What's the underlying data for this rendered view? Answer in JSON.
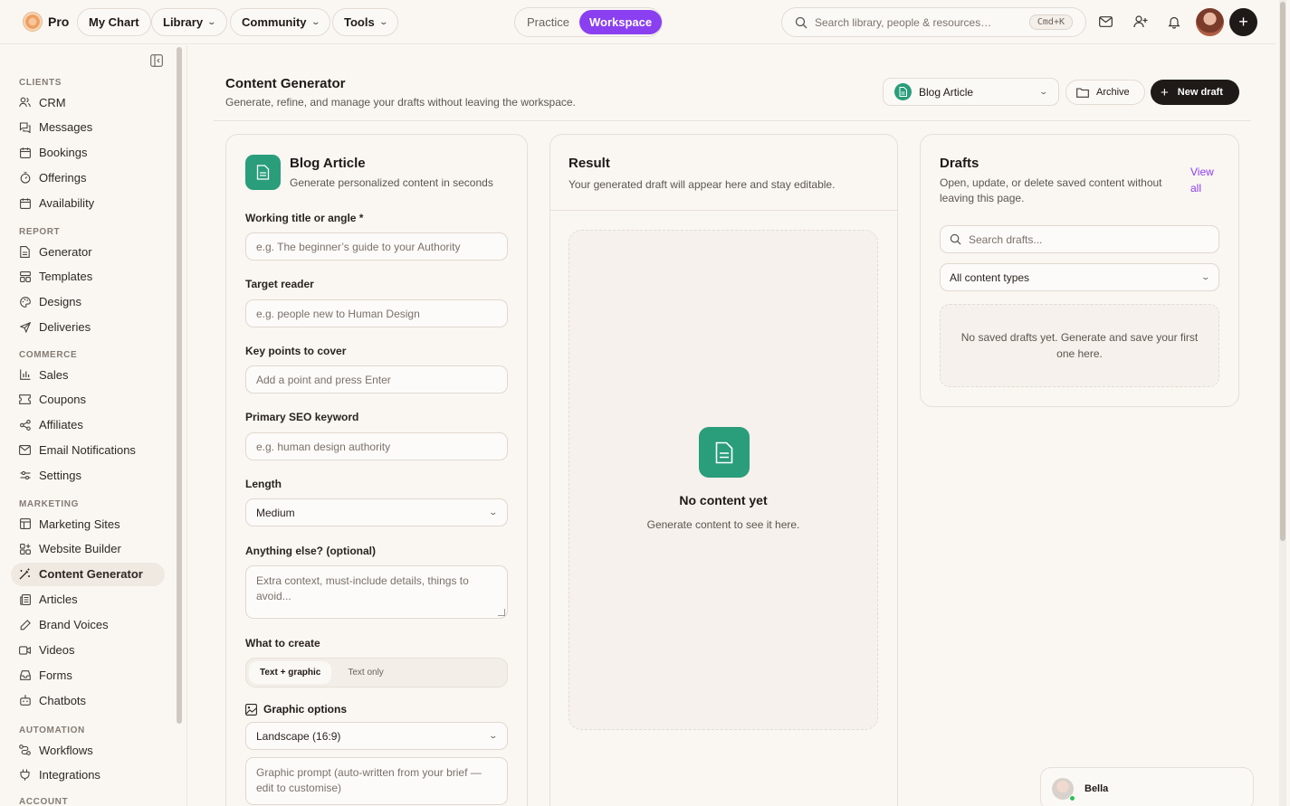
{
  "app": {
    "brand": "Pro"
  },
  "topnav": {
    "items": [
      {
        "label": "My Chart",
        "has_menu": false
      },
      {
        "label": "Library",
        "has_menu": true
      },
      {
        "label": "Community",
        "has_menu": true
      },
      {
        "label": "Tools",
        "has_menu": true
      }
    ],
    "mode_toggle": {
      "options": [
        "Practice",
        "Workspace"
      ],
      "selected": "Workspace"
    },
    "search": {
      "placeholder": "Search library, people & resources…",
      "shortcut": "Cmd+K"
    }
  },
  "sidebar": {
    "sections": [
      {
        "title": "CLIENTS",
        "items": [
          {
            "label": "CRM",
            "icon": "users-icon"
          },
          {
            "label": "Messages",
            "icon": "messages-icon"
          },
          {
            "label": "Bookings",
            "icon": "calendar-icon"
          },
          {
            "label": "Offerings",
            "icon": "timer-icon"
          },
          {
            "label": "Availability",
            "icon": "calendar-icon"
          }
        ]
      },
      {
        "title": "REPORT",
        "items": [
          {
            "label": "Generator",
            "icon": "document-icon"
          },
          {
            "label": "Templates",
            "icon": "templates-icon"
          },
          {
            "label": "Designs",
            "icon": "palette-icon"
          },
          {
            "label": "Deliveries",
            "icon": "send-icon"
          }
        ]
      },
      {
        "title": "COMMERCE",
        "items": [
          {
            "label": "Sales",
            "icon": "bar-chart-icon"
          },
          {
            "label": "Coupons",
            "icon": "ticket-icon"
          },
          {
            "label": "Affiliates",
            "icon": "share-icon"
          },
          {
            "label": "Email Notifications",
            "icon": "mail-icon"
          },
          {
            "label": "Settings",
            "icon": "sliders-icon"
          }
        ]
      },
      {
        "title": "MARKETING",
        "items": [
          {
            "label": "Marketing Sites",
            "icon": "layout-icon"
          },
          {
            "label": "Website Builder",
            "icon": "blocks-icon"
          },
          {
            "label": "Content Generator",
            "icon": "magic-wand-icon",
            "active": true
          },
          {
            "label": "Articles",
            "icon": "newspaper-icon"
          },
          {
            "label": "Brand Voices",
            "icon": "pen-icon"
          },
          {
            "label": "Videos",
            "icon": "video-icon"
          },
          {
            "label": "Forms",
            "icon": "inbox-icon"
          },
          {
            "label": "Chatbots",
            "icon": "bot-icon"
          }
        ]
      },
      {
        "title": "AUTOMATION",
        "items": [
          {
            "label": "Workflows",
            "icon": "workflow-icon"
          },
          {
            "label": "Integrations",
            "icon": "plug-icon"
          }
        ]
      },
      {
        "title": "ACCOUNT",
        "items": []
      }
    ]
  },
  "header": {
    "title": "Content Generator",
    "subtitle": "Generate, refine, and manage your drafts without leaving the workspace.",
    "content_type_select": "Blog Article",
    "archive_label": "Archive",
    "new_draft_label": "New draft"
  },
  "generator": {
    "title": "Blog Article",
    "subtitle": "Generate personalized content in seconds",
    "fields": {
      "working_title": {
        "label": "Working title or angle *",
        "placeholder": "e.g. The beginner’s guide to your Authority"
      },
      "target_reader": {
        "label": "Target reader",
        "placeholder": "e.g. people new to Human Design"
      },
      "key_points": {
        "label": "Key points to cover",
        "placeholder": "Add a point and press Enter"
      },
      "seo_keyword": {
        "label": "Primary SEO keyword",
        "placeholder": "e.g. human design authority"
      },
      "length": {
        "label": "Length",
        "value": "Medium"
      },
      "anything_else": {
        "label": "Anything else? (optional)",
        "placeholder": "Extra context, must-include details, things to avoid..."
      },
      "what_to_create": {
        "label": "What to create",
        "options": [
          "Text + graphic",
          "Text only"
        ],
        "selected": "Text + graphic"
      },
      "graphic_options": {
        "label": "Graphic options",
        "aspect": "Landscape (16:9)",
        "prompt_placeholder": "Graphic prompt (auto-written from your brief — edit to customise)"
      }
    }
  },
  "result": {
    "title": "Result",
    "subtitle": "Your generated draft will appear here and stay editable.",
    "empty_title": "No content yet",
    "empty_subtitle": "Generate content to see it here."
  },
  "drafts": {
    "title": "Drafts",
    "subtitle": "Open, update, or delete saved content without leaving this page.",
    "view_all": "View all",
    "search_placeholder": "Search drafts...",
    "filter": "All content types",
    "empty": "No saved drafts yet. Generate and save your first one here."
  },
  "assistant": {
    "name": "Bella",
    "status_color": "#2bbf55"
  },
  "colors": {
    "accent": "#8a3ff0",
    "brand_green": "#2a9d7a",
    "dark": "#1f1a17"
  }
}
